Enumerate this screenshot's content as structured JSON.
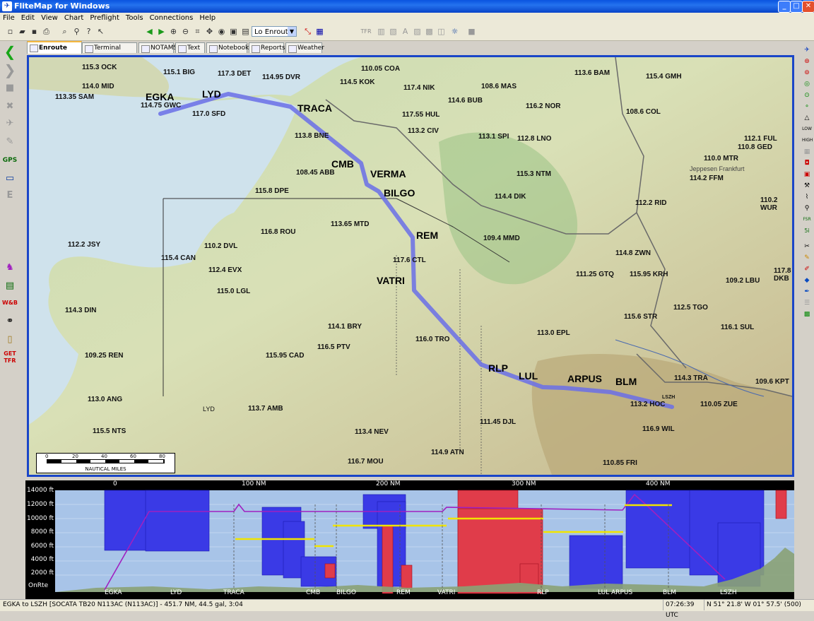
{
  "window": {
    "title": "FliteMap for Windows",
    "btn_min": "_",
    "btn_max": "□",
    "btn_close": "✕"
  },
  "menu": [
    "File",
    "Edit",
    "View",
    "Chart",
    "Preflight",
    "Tools",
    "Connections",
    "Help"
  ],
  "toolbar": {
    "chart_select": "Lo Enroute",
    "tfr_label": "TFR"
  },
  "tabs": [
    {
      "label": "Enroute Charts",
      "active": true
    },
    {
      "label": "Terminal Charts"
    },
    {
      "label": "NOTAMS"
    },
    {
      "label": "Text"
    },
    {
      "label": "Notebook"
    },
    {
      "label": "Reports"
    },
    {
      "label": "Weather"
    }
  ],
  "left_tools": {
    "gps": "GPS",
    "wb": "W&B",
    "get_tfr": "GET TFR"
  },
  "right_tools": {
    "low": "LOW",
    "high": "HIGH",
    "fsr": "FSR",
    "five": "5i"
  },
  "map": {
    "waypoints": [
      "EGKA",
      "LYD",
      "TRACA",
      "CMB",
      "VERMA",
      "BILGO",
      "REM",
      "VATRI",
      "RLP",
      "LUL",
      "ARPUS",
      "BLM"
    ],
    "navaids": [
      "115.3 OCK",
      "115.1 BIG",
      "117.3 DET",
      "114.95 DVR",
      "110.05 COA",
      "117.4 NIK",
      "108.6 MAS",
      "113.6 BAM",
      "115.4 GMH",
      "114.0 MID",
      "113.35 SAM",
      "114.75 GWC",
      "117.0 SFD",
      "114.5 KOK",
      "114.6 BUB",
      "116.2 NOR",
      "108.6 COL",
      "117.55 HUL",
      "113.2 CIV",
      "113.1 SPI",
      "112.8 LNO",
      "112.1 FUL",
      "110.8 GED",
      "110.0 MTR",
      "113.8 BNE",
      "108.45 ABB",
      "115.8 DPE",
      "115.3 NTM",
      "114.4 DIK",
      "114.2 FFM",
      "112.2 RID",
      "110.2 WUR",
      "116.8 ROU",
      "113.65 MTD",
      "112.2 JSY",
      "110.2 DVL",
      "109.4 MMD",
      "114.8 ZWN",
      "115.4 CAN",
      "112.4 EVX",
      "117.6 CTL",
      "111.25 GTQ",
      "115.95 KRH",
      "117.8 DKB",
      "109.2 LBU",
      "115.0 LGL",
      "114.3 DIN",
      "112.5 TGO",
      "115.6 STR",
      "116.1 SUL",
      "114.1 BRY",
      "116.0 TRO",
      "113.0 EPL",
      "109.25 REN",
      "115.95 CAD",
      "116.5 PTV",
      "114.3 TRA",
      "109.6 KPT",
      "113.2 HOC",
      "110.05 ZUE",
      "113.0 ANG",
      "113.7 AMB",
      "111.45 DJL",
      "115.5 NTS",
      "113.4 NEV",
      "114.9 ATN",
      "116.9 WIL",
      "116.7 MOU",
      "110.85 FRI"
    ],
    "lsz_label": "LSZH",
    "jeppesen_label": "Jeppesen Frankfurt",
    "lyd_label": "LYD",
    "scale": {
      "ticks": [
        "0",
        "20",
        "40",
        "60",
        "80"
      ],
      "unit": "NAUTICAL MILES"
    }
  },
  "profile": {
    "nm_ticks": [
      "0",
      "100 NM",
      "200 NM",
      "300 NM",
      "400 NM"
    ],
    "alt_ticks": [
      "14000 ft",
      "12000 ft",
      "10000 ft",
      "8000 ft",
      "6000 ft",
      "4000 ft",
      "2000 ft"
    ],
    "onrte": "OnRte",
    "waypoints": [
      "EGKA",
      "LYD",
      "TRACA",
      "CMB",
      "BILGO",
      "REM",
      "VATRI",
      "RLP",
      "LUL ARPUS",
      "BLM",
      "LSZH"
    ]
  },
  "status": {
    "route": "EGKA to LSZH [SOCATA TB20 N113AC (N113AC)] - 451.7 NM, 44.5 gal, 3:04",
    "time": "07:26:39 UTC",
    "pos": "N 51° 21.8' W 01° 57.5' (500)"
  },
  "colors": {
    "route": "#6a6ee8",
    "map_border": "#1a45c8",
    "airspace_blue": "#3a3ae6",
    "airspace_red": "#e03c4a",
    "profile_bg": "#a8c4e8"
  }
}
